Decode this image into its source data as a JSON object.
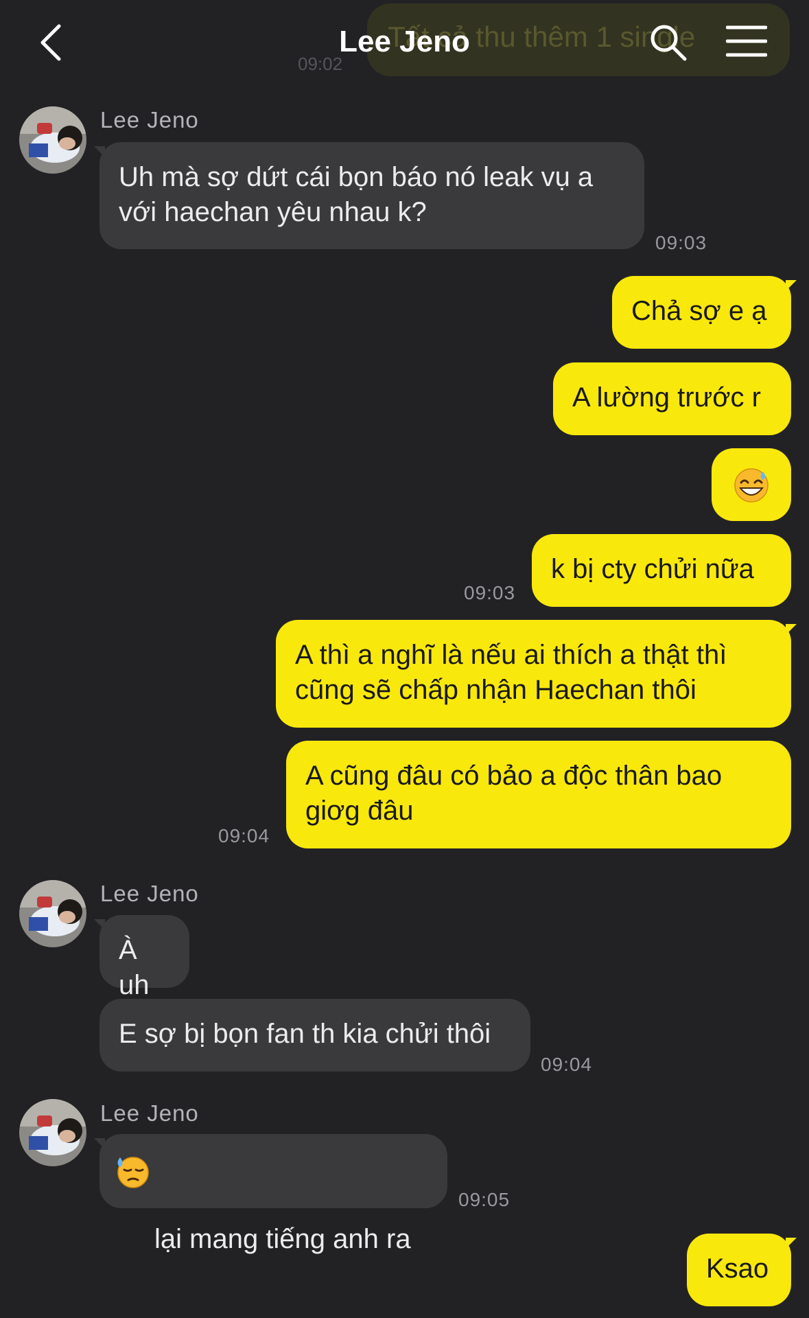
{
  "header": {
    "title": "Lee Jeno",
    "ghost_text": "Tất cả thu thêm 1 single",
    "ghost_time": "09:02",
    "back_icon": "chevron-left-icon",
    "search_icon": "search-icon",
    "menu_icon": "hamburger-menu-icon"
  },
  "colors": {
    "background": "#222225",
    "incoming_bubble": "#3a3a3c",
    "outgoing_bubble": "#f9e80c",
    "timestamp": "#9a9a9e"
  },
  "messages": {
    "m1": {
      "sender": "Lee Jeno",
      "text": "Uh mà sợ dứt cái bọn báo nó leak vụ a\nvới haechan yêu nhau k?",
      "time": "09:03"
    },
    "m2": {
      "text": "Chả sợ e ạ"
    },
    "m3": {
      "text": "A lường trước r"
    },
    "m4": {
      "emoji": "grinning-face-with-sweat"
    },
    "m5": {
      "text": "k bị cty chửi nữa",
      "time": "09:03"
    },
    "m6": {
      "text": "A thì a nghĩ là nếu ai thích a thật thì\ncũng sẽ chấp nhận Haechan thôi"
    },
    "m7": {
      "text": "A cũng đâu có bảo a độc thân bao\ngiơg đâu",
      "time": "09:04"
    },
    "m8": {
      "sender": "Lee Jeno",
      "text": "À uh"
    },
    "m9": {
      "text": "E sợ bị bọn fan th kia chửi thôi",
      "time": "09:04"
    },
    "m10": {
      "sender": "Lee Jeno",
      "emoji": "downcast-face-with-sweat",
      "text": "lại mang tiếng anh ra",
      "time": "09:05"
    },
    "m11": {
      "text": "Ksao"
    }
  }
}
